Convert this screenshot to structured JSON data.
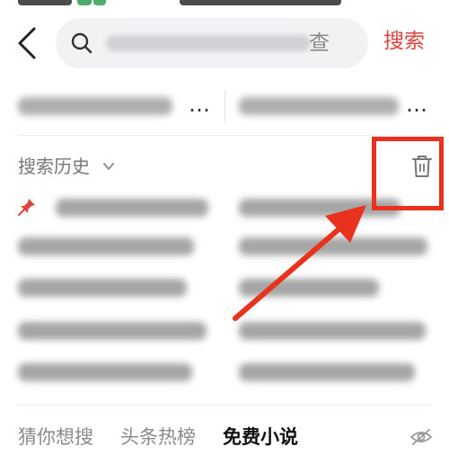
{
  "search": {
    "query_visible_tail": "查",
    "submit_label": "搜索"
  },
  "suggestions": [
    {
      "ellipsis": "…"
    },
    {
      "ellipsis": "…"
    }
  ],
  "history": {
    "title": "搜索历史"
  },
  "tabs": [
    {
      "label": "猜你想搜",
      "active": false
    },
    {
      "label": "头条热榜",
      "active": false
    },
    {
      "label": "免费小说",
      "active": true
    }
  ],
  "colors": {
    "accent": "#e0423c",
    "annotation": "#e8321e",
    "search_bg": "#f2f2f4"
  }
}
